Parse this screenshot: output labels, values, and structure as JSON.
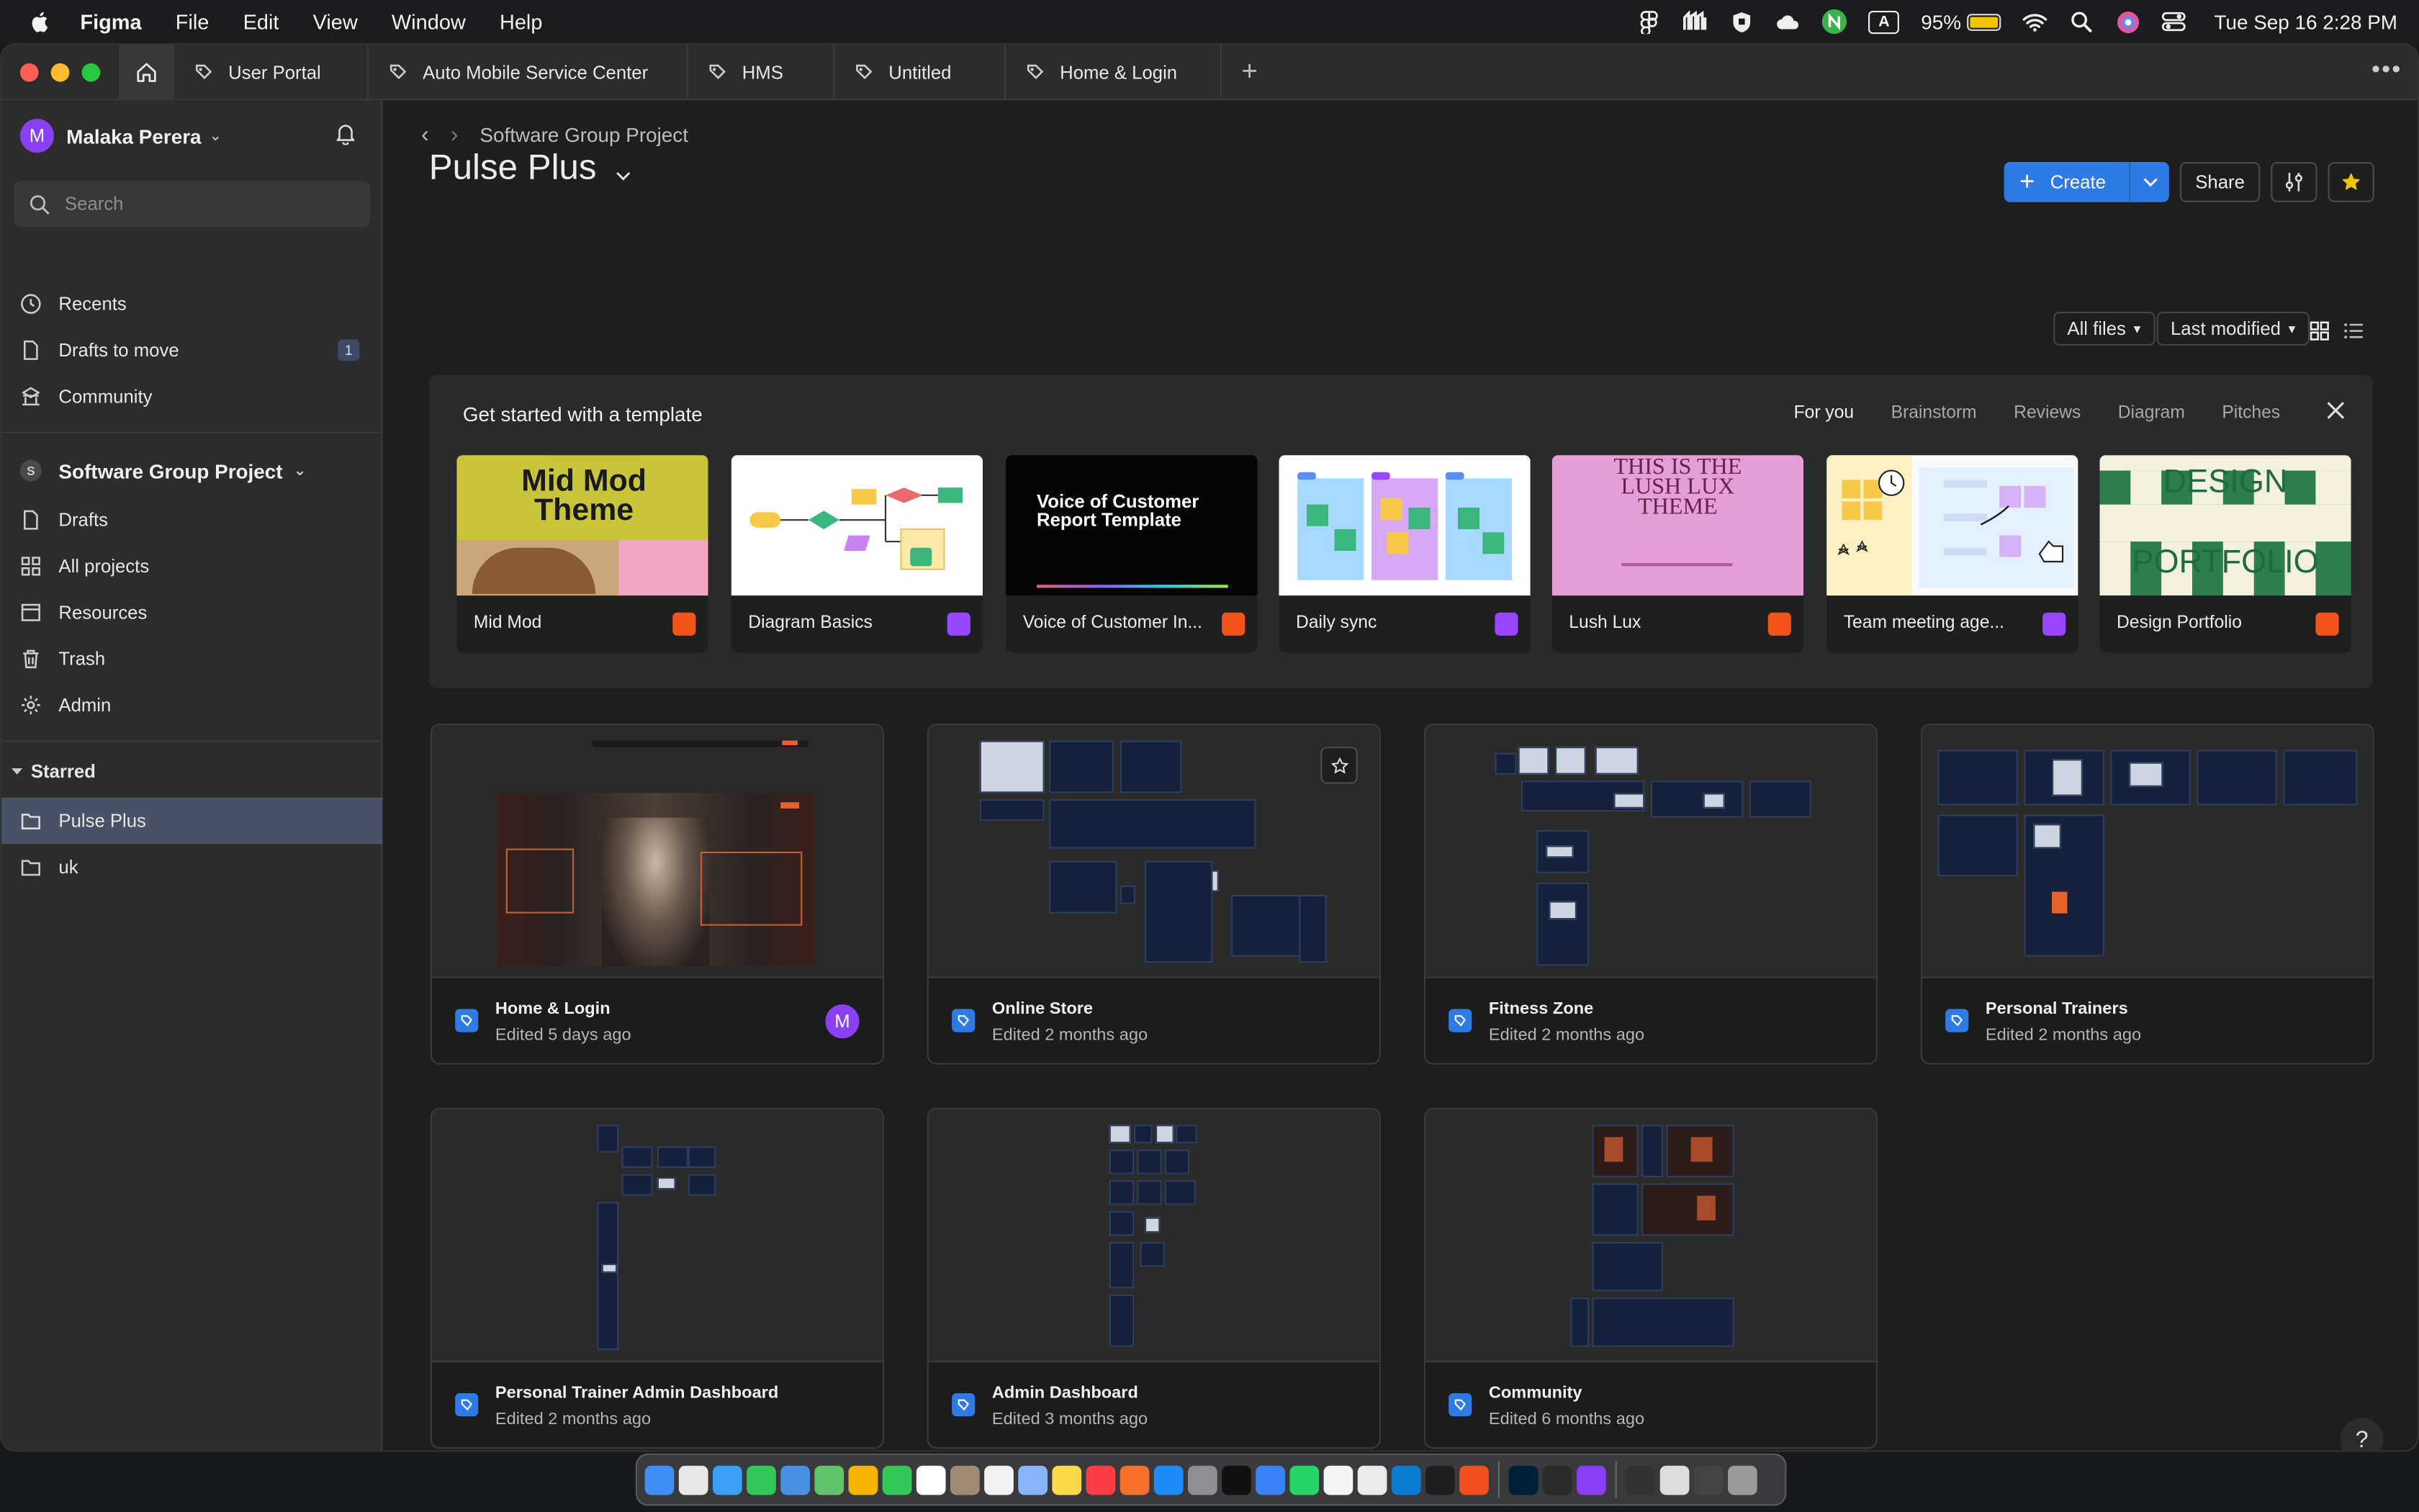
{
  "menubar": {
    "app": "Figma",
    "items": [
      "File",
      "Edit",
      "View",
      "Window",
      "Help"
    ],
    "battery": "95%",
    "datetime": "Tue Sep 16  2:28 PM",
    "input_source": "A"
  },
  "tabs": [
    "User Portal",
    "Auto Mobile Service Center",
    "HMS",
    "Untitled",
    "Home & Login"
  ],
  "sidebar": {
    "user": "Malaka Perera",
    "user_initial": "M",
    "search_placeholder": "Search",
    "nav": [
      {
        "label": "Recents",
        "icon": "clock-icon"
      },
      {
        "label": "Drafts to move",
        "icon": "file-icon",
        "badge": "1"
      },
      {
        "label": "Community",
        "icon": "globe-icon"
      }
    ],
    "team": "Software Group Project",
    "team_initial": "S",
    "team_nav": [
      {
        "label": "Drafts",
        "icon": "file-icon"
      },
      {
        "label": "All projects",
        "icon": "grid-icon"
      },
      {
        "label": "Resources",
        "icon": "book-icon"
      },
      {
        "label": "Trash",
        "icon": "trash-icon"
      },
      {
        "label": "Admin",
        "icon": "gear-icon"
      }
    ],
    "starred_label": "Starred",
    "starred": [
      {
        "label": "Pulse Plus",
        "active": true
      },
      {
        "label": "uk",
        "active": false
      }
    ]
  },
  "main": {
    "breadcrumb": "Software Group Project",
    "title": "Pulse Plus",
    "create_label": "Create",
    "share_label": "Share",
    "filter_files": "All files",
    "filter_sort": "Last modified",
    "accent": "#2f7be5"
  },
  "templates": {
    "title": "Get started with a template",
    "tabs": [
      "For you",
      "Brainstorm",
      "Reviews",
      "Diagram",
      "Pitches"
    ],
    "cards": [
      {
        "name": "Mid Mod",
        "kind": "slides",
        "thumb_text": "Mid Mod Theme"
      },
      {
        "name": "Diagram Basics",
        "kind": "figjam"
      },
      {
        "name": "Voice of Customer In...",
        "kind": "slides",
        "thumb_text": "Voice of Customer Report Template"
      },
      {
        "name": "Daily sync",
        "kind": "figjam"
      },
      {
        "name": "Lush Lux",
        "kind": "slides",
        "thumb_text": "THIS IS THE LUSH LUX THEME"
      },
      {
        "name": "Team meeting age...",
        "kind": "figjam"
      },
      {
        "name": "Design Portfolio",
        "kind": "slides",
        "thumb_text_top": "DESIGN",
        "thumb_text_bottom": "PORTFOLIO"
      }
    ]
  },
  "files": [
    {
      "name": "Home & Login",
      "edited": "Edited 5 days ago",
      "avatar": "M"
    },
    {
      "name": "Online Store",
      "edited": "Edited 2 months ago"
    },
    {
      "name": "Fitness Zone",
      "edited": "Edited 2 months ago"
    },
    {
      "name": "Personal Trainers",
      "edited": "Edited 2 months ago"
    },
    {
      "name": "Personal Trainer Admin Dashboard",
      "edited": "Edited 2 months ago"
    },
    {
      "name": "Admin Dashboard",
      "edited": "Edited 3 months ago"
    },
    {
      "name": "Community",
      "edited": "Edited 6 months ago"
    }
  ],
  "help_label": "?"
}
